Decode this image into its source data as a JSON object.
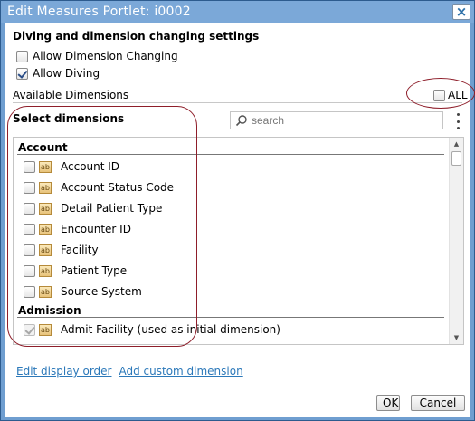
{
  "window": {
    "title": "Edit Measures Portlet: i0002",
    "close_glyph": "×"
  },
  "settings": {
    "heading": "Diving and dimension changing settings",
    "allow_dimension_changing": {
      "label": "Allow Dimension Changing",
      "checked": false
    },
    "allow_diving": {
      "label": "Allow Diving",
      "checked": true
    }
  },
  "available": {
    "label": "Available Dimensions",
    "all_label": "ALL",
    "all_checked": false
  },
  "select": {
    "heading": "Select dimensions",
    "search_placeholder": "search",
    "search_icon": "search-icon",
    "menu_icon": "vertical-ellipsis-icon"
  },
  "groups": [
    {
      "name": "Account",
      "items": [
        {
          "label": "Account ID",
          "checked": false
        },
        {
          "label": "Account Status Code",
          "checked": false
        },
        {
          "label": "Detail Patient Type",
          "checked": false
        },
        {
          "label": "Encounter ID",
          "checked": false
        },
        {
          "label": "Facility",
          "checked": false
        },
        {
          "label": "Patient Type",
          "checked": false
        },
        {
          "label": "Source System",
          "checked": false
        }
      ]
    },
    {
      "name": "Admission",
      "items": [
        {
          "label": "Admit Facility (used as initial dimension)",
          "checked": true,
          "disabled": true
        }
      ]
    }
  ],
  "item_icon_text": "ab",
  "links": {
    "edit_display_order": "Edit display order",
    "add_custom_dimension": "Add custom dimension"
  },
  "buttons": {
    "ok": "OK",
    "cancel": "Cancel"
  },
  "colors": {
    "title_bar": "#7ba8d8",
    "link": "#2b78b9",
    "annotation_outline": "#8e1e2a"
  }
}
